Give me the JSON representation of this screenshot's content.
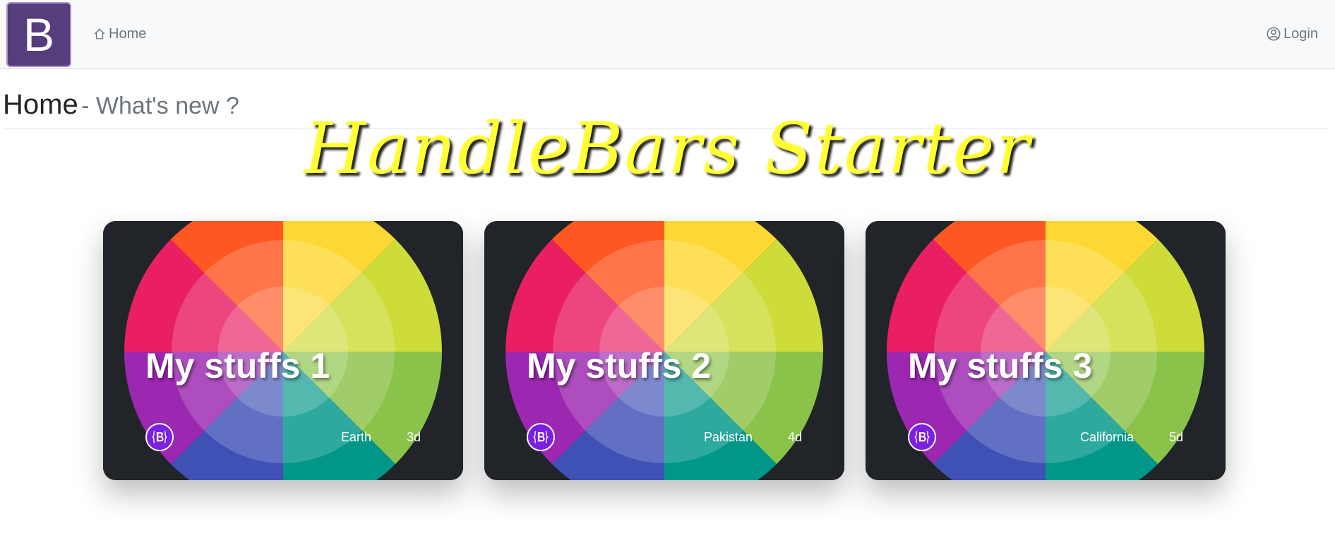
{
  "navbar": {
    "brand_letter": "B",
    "home_label": "Home",
    "login_label": "Login",
    "brand_color": "#563d7c"
  },
  "page": {
    "title": "Home",
    "subtitle": "- What's new ?",
    "hero_title": "HandleBars Starter"
  },
  "cards": [
    {
      "title": "My stuffs 1",
      "location": "Earth",
      "age": "3d"
    },
    {
      "title": "My stuffs 2",
      "location": "Pakistan",
      "age": "4d"
    },
    {
      "title": "My stuffs 3",
      "location": "California",
      "age": "5d"
    }
  ]
}
